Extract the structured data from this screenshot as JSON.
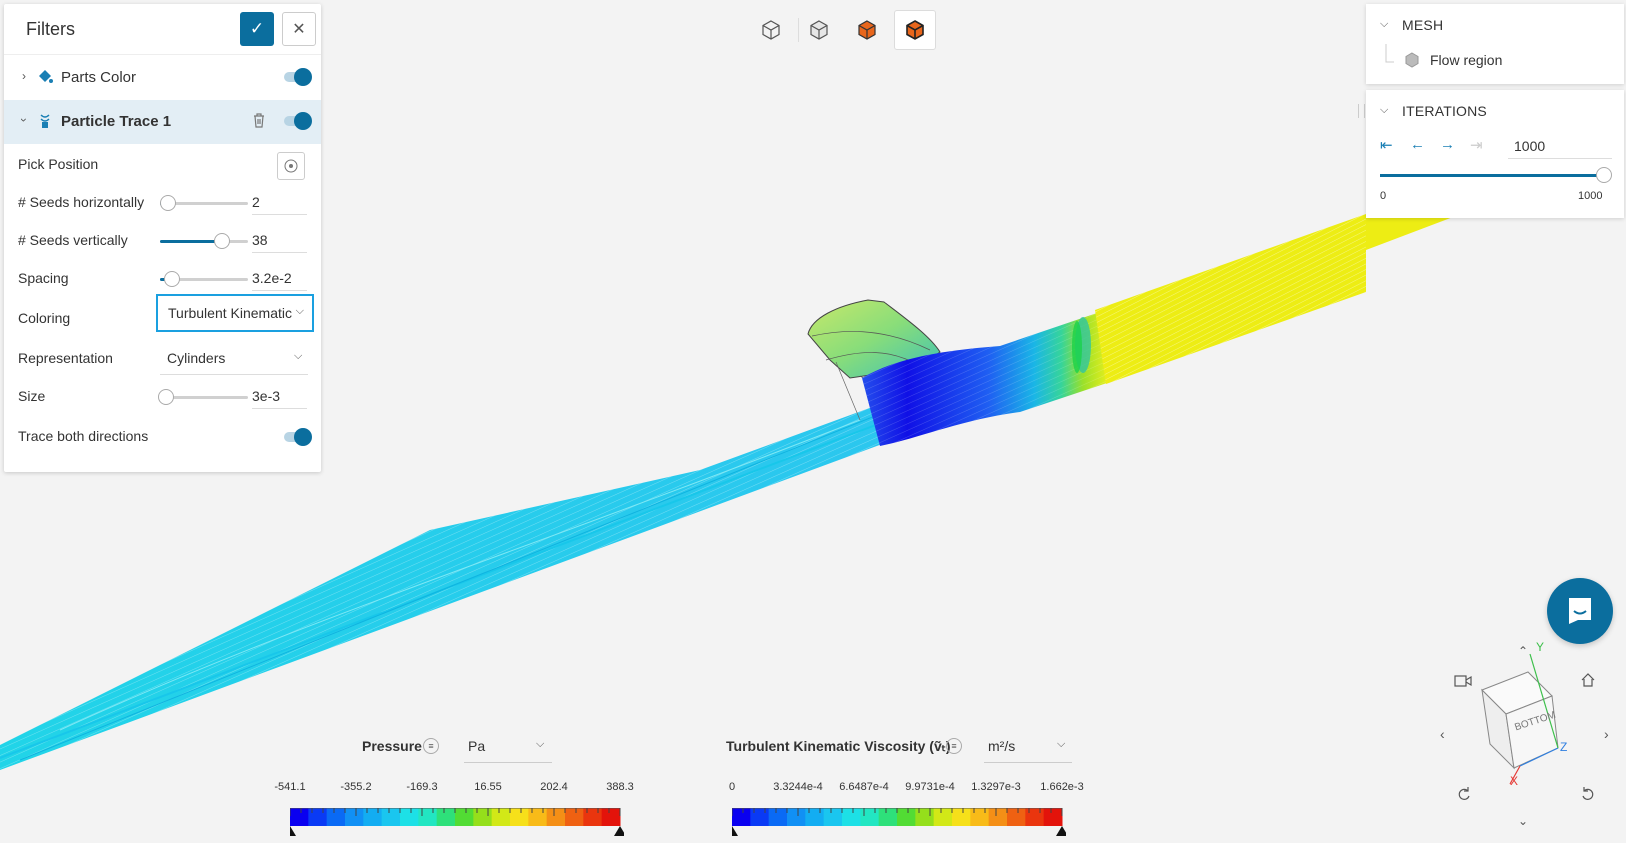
{
  "filters": {
    "title": "Filters",
    "items": [
      {
        "label": "Parts Color",
        "enabled": true
      },
      {
        "label": "Particle Trace 1",
        "enabled": true
      }
    ],
    "properties": {
      "pick_position": {
        "label": "Pick Position"
      },
      "seeds_horizontally": {
        "label": "# Seeds horizontally",
        "value": "2"
      },
      "seeds_vertically": {
        "label": "# Seeds vertically",
        "value": "38"
      },
      "spacing": {
        "label": "Spacing",
        "value": "3.2e-2"
      },
      "coloring": {
        "label": "Coloring",
        "value": "Turbulent Kinematic Viscosity"
      },
      "representation": {
        "label": "Representation",
        "value": "Cylinders"
      },
      "size": {
        "label": "Size",
        "value": "3e-3"
      },
      "trace_both": {
        "label": "Trace both directions",
        "enabled": true
      }
    }
  },
  "mesh_panel": {
    "title": "MESH",
    "item": "Flow region"
  },
  "iterations_panel": {
    "title": "ITERATIONS",
    "value": "1000",
    "min": "0",
    "max": "1000",
    "level": 1.0
  },
  "legend_pressure": {
    "title": "Pressure",
    "unit": "Pa",
    "ticks": [
      "-541.1",
      "-355.2",
      "-169.3",
      "16.55",
      "202.4",
      "388.3"
    ]
  },
  "legend_tkv": {
    "title": "Turbulent Kinematic Viscosity (ṽₜ)",
    "unit": "m²/s",
    "ticks": [
      "0",
      "3.3244e-4",
      "6.6487e-4",
      "9.9731e-4",
      "1.3297e-3",
      "1.662e-3"
    ]
  },
  "orientation_cube": {
    "face_label": "BOTTOM",
    "axes": [
      "X",
      "Y",
      "Z"
    ]
  },
  "colors": {
    "accent": "#0b6e9e",
    "focus": "#1aa0e0",
    "highlight_row": "#e3eef5"
  }
}
